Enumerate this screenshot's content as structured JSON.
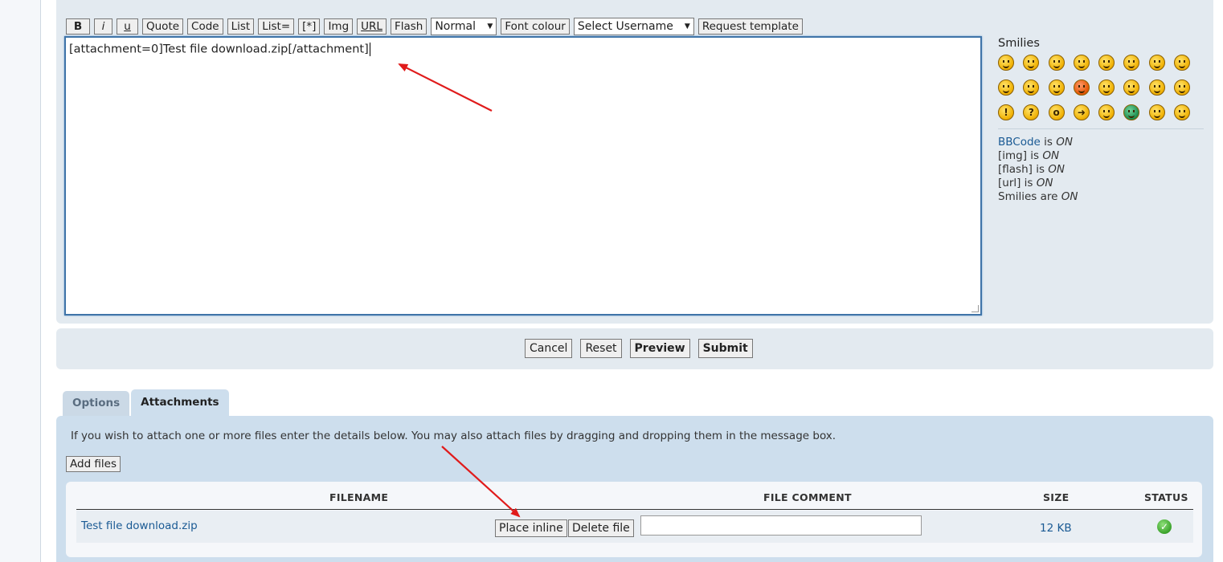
{
  "toolbar": {
    "bold": "B",
    "italic": "i",
    "underline": "u",
    "quote": "Quote",
    "code": "Code",
    "list": "List",
    "list_ordered": "List=",
    "list_item": "[*]",
    "img": "Img",
    "url": "URL",
    "flash": "Flash",
    "font_size_value": "Normal",
    "font_colour": "Font colour",
    "username_value": "Select Username",
    "request_template": "Request template"
  },
  "editor": {
    "value": "[attachment=0]Test file download.zip[/attachment]"
  },
  "sidebar": {
    "smilies_title": "Smilies",
    "bbcode_link": "BBCode",
    "bbcode_is": " is ",
    "on": "ON",
    "img_label": "[img] is ",
    "flash_label": "[flash] is ",
    "url_label": "[url] is ",
    "smilies_label": "Smilies are "
  },
  "actions": {
    "cancel": "Cancel",
    "reset": "Reset",
    "preview": "Preview",
    "submit": "Submit"
  },
  "tabs": {
    "options": "Options",
    "attachments": "Attachments"
  },
  "attachments": {
    "info": "If you wish to attach one or more files enter the details below. You may also attach files by dragging and dropping them in the message box.",
    "add_files": "Add files",
    "headers": {
      "filename": "FILENAME",
      "file_comment": "FILE COMMENT",
      "size": "SIZE",
      "status": "STATUS"
    },
    "rows": [
      {
        "filename": "Test file download.zip",
        "place_inline": "Place inline",
        "delete_file": "Delete file",
        "comment": "",
        "size": "12 KB",
        "status_icon": "check-icon"
      }
    ]
  },
  "colors": {
    "panel": "#e3eaf0",
    "attachment_panel": "#cddeed",
    "link": "#1a5a94",
    "annotation_arrow": "#e01b1b"
  }
}
